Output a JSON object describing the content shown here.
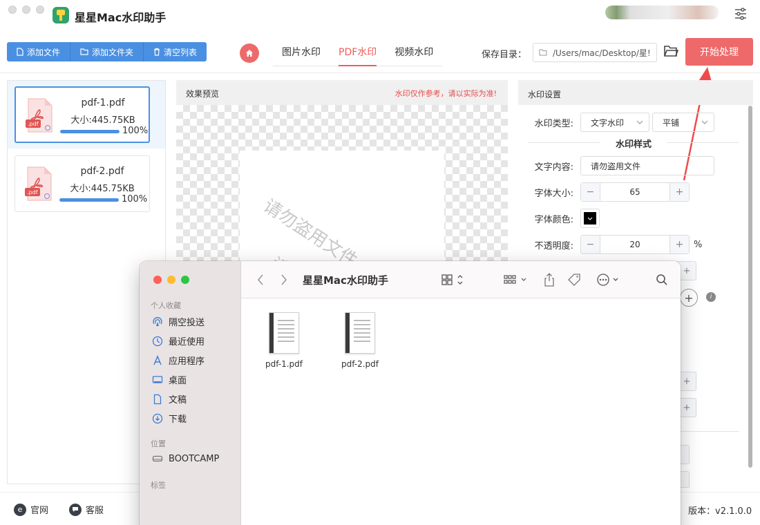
{
  "app": {
    "title": "星星Mac水印助手"
  },
  "toolbar": {
    "add_file": "添加文件",
    "add_folder": "添加文件夹",
    "clear_list": "清空列表",
    "tabs": [
      {
        "label": "图片水印"
      },
      {
        "label": "PDF水印",
        "active": true
      },
      {
        "label": "视频水印"
      }
    ],
    "save_label": "保存目录：",
    "save_path": "/Users/mac/Desktop/星!",
    "start_button": "开始处理"
  },
  "files": [
    {
      "name": "pdf-1.pdf",
      "size": "大小:445.75KB",
      "progress": "100%",
      "progress_value": 100,
      "selected": true
    },
    {
      "name": "pdf-2.pdf",
      "size": "大小:445.75KB",
      "progress": "100%",
      "progress_value": 100,
      "selected": false
    }
  ],
  "preview": {
    "title": "效果预览",
    "note": "水印仅作参考，请以实际为准!",
    "watermark_text": "请勿盗用文件",
    "watermark_text_partial": "请"
  },
  "settings": {
    "header": "水印设置",
    "type_label": "水印类型:",
    "type_value": "文字水印",
    "layout_value": "平铺",
    "style_section": "水印样式",
    "text_label": "文字内容:",
    "text_value": "请勿盗用文件",
    "font_size_label": "字体大小:",
    "font_size_value": "65",
    "font_color_label": "字体颜色:",
    "font_color": "#000000",
    "opacity_label": "不透明度:",
    "opacity_value": "20",
    "opacity_unit": "%"
  },
  "footer": {
    "website": "官网",
    "support": "客服",
    "version": "版本：v2.1.0.0"
  },
  "finder": {
    "title": "星星Mac水印助手",
    "favorites_label": "个人收藏",
    "favorites": [
      {
        "label": "隔空投送",
        "icon": "airdrop-icon"
      },
      {
        "label": "最近使用",
        "icon": "clock-icon"
      },
      {
        "label": "应用程序",
        "icon": "applications-icon"
      },
      {
        "label": "桌面",
        "icon": "desktop-icon"
      },
      {
        "label": "文稿",
        "icon": "document-icon"
      },
      {
        "label": "下载",
        "icon": "download-icon"
      }
    ],
    "locations_label": "位置",
    "locations": [
      {
        "label": "BOOTCAMP",
        "icon": "drive-icon"
      }
    ],
    "tags_label": "标签",
    "items": [
      {
        "name": "pdf-1.pdf"
      },
      {
        "name": "pdf-2.pdf"
      }
    ]
  },
  "colors": {
    "accent_blue": "#4a90e2",
    "accent_red": "#ee6a6a"
  }
}
